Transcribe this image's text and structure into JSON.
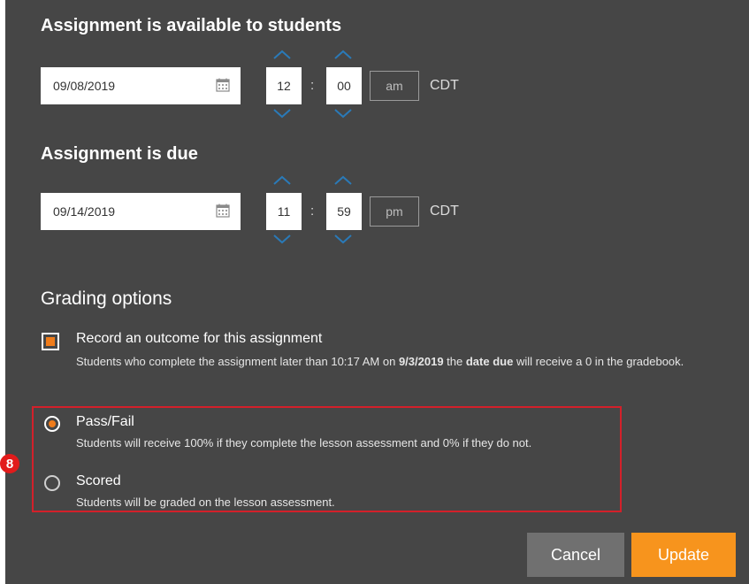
{
  "colors": {
    "panel": "#464646",
    "accent": "#f07c1a",
    "button_update": "#f7941d",
    "button_cancel": "#707070",
    "highlight": "#d3202a"
  },
  "available": {
    "title": "Assignment is available to students",
    "date": "09/08/2019",
    "hour": "12",
    "minute": "00",
    "separator": ":",
    "ampm": "am",
    "timezone": "CDT"
  },
  "due": {
    "title": "Assignment is due",
    "date": "09/14/2019",
    "hour": "11",
    "minute": "59",
    "separator": ":",
    "ampm": "pm",
    "timezone": "CDT"
  },
  "grading": {
    "title": "Grading options",
    "record": {
      "checked": true,
      "label": "Record an outcome for this assignment",
      "desc_part1": "Students who complete the assignment later than 10:17 AM on ",
      "desc_date": "9/3/2019",
      "desc_part2": " the ",
      "desc_bold": "date due",
      "desc_part3": " will receive a 0 in the gradebook."
    },
    "options": [
      {
        "label": "Pass/Fail",
        "desc": "Students will receive 100% if they complete the lesson assessment and 0% if they do not.",
        "selected": true
      },
      {
        "label": "Scored",
        "desc": "Students will be graded on the lesson assessment.",
        "selected": false
      }
    ]
  },
  "annotation": {
    "step": "8"
  },
  "buttons": {
    "cancel": "Cancel",
    "update": "Update"
  }
}
